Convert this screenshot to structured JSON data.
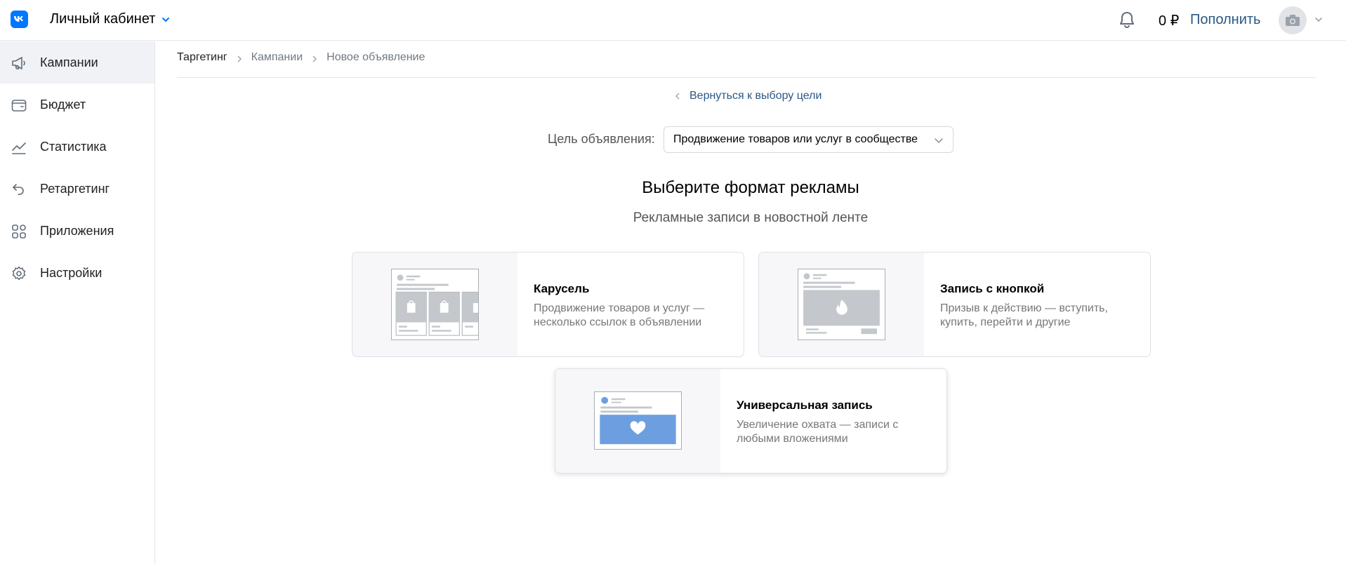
{
  "header": {
    "title": "Личный кабинет",
    "balance": "0 ₽",
    "topup_label": "Пополнить",
    "accent": "#0077ff",
    "link_color": "#2a5885"
  },
  "sidebar": {
    "items": [
      {
        "label": "Кампании",
        "icon": "megaphone-icon",
        "active": true
      },
      {
        "label": "Бюджет",
        "icon": "wallet-icon",
        "active": false
      },
      {
        "label": "Статистика",
        "icon": "chart-icon",
        "active": false
      },
      {
        "label": "Ретаргетинг",
        "icon": "retarget-icon",
        "active": false
      },
      {
        "label": "Приложения",
        "icon": "apps-icon",
        "active": false
      },
      {
        "label": "Настройки",
        "icon": "gear-icon",
        "active": false
      }
    ]
  },
  "breadcrumbs": [
    "Таргетинг",
    "Кампании",
    "Новое объявление"
  ],
  "main": {
    "back_link": "Вернуться к выбору цели",
    "goal_label": "Цель объявления:",
    "goal_value": "Продвижение товаров или услуг в сообществе",
    "format_title": "Выберите формат рекламы",
    "format_subtitle": "Рекламные записи в новостной ленте",
    "cards": [
      {
        "title": "Карусель",
        "description": "Продвижение товаров и услуг — несколько ссылок в объявлении",
        "icon": "shopping-bag-icon"
      },
      {
        "title": "Запись с кнопкой",
        "description": "Призыв к действию — вступить, купить, перейти и другие",
        "icon": "flame-icon"
      },
      {
        "title": "Универсальная запись",
        "description": "Увеличение охвата — записи с любыми вложениями",
        "icon": "heart-icon"
      }
    ]
  }
}
